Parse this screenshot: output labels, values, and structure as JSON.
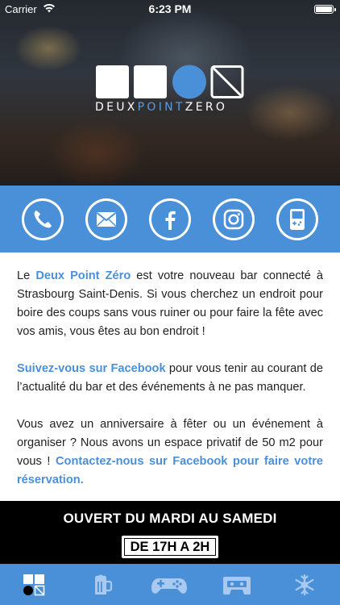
{
  "status_bar": {
    "carrier": "Carrier",
    "time": "6:23 PM"
  },
  "logo": {
    "part1": "DEUX",
    "part2": "POINT",
    "part3": "ZERO"
  },
  "social": [
    {
      "name": "phone-icon"
    },
    {
      "name": "mail-icon"
    },
    {
      "name": "facebook-icon"
    },
    {
      "name": "instagram-icon"
    },
    {
      "name": "gameboy-icon"
    }
  ],
  "content": {
    "p1_pre": "Le ",
    "p1_link": "Deux Point Zéro",
    "p1_post": " est votre nouveau bar connecté à Strasbourg Saint-Denis. Si vous cherchez un endroit pour boire des coups sans vous ruiner ou pour faire la fête avec vos amis, vous êtes au bon endroit !",
    "p2_link": "Suivez-vous sur Facebook",
    "p2_post": " pour vous tenir au courant de l’actualité du bar et des événements à ne pas manquer.",
    "p3_pre": "Vous avez un anniversaire à fêter ou un événement à organiser ? Nous avons un espace privatif de 50 m2 pour vous ! ",
    "p3_link": "Contactez-nous sur Facebook pour faire votre réservation."
  },
  "hours": {
    "title": "OUVERT DU MARDI AU SAMEDI",
    "time": "DE 17H A 2H"
  },
  "tabs": [
    {
      "name": "home-tab",
      "icon": "logo-icon",
      "active": true
    },
    {
      "name": "drinks-tab",
      "icon": "beer-icon",
      "active": false
    },
    {
      "name": "games-tab",
      "icon": "gamepad-icon",
      "active": false
    },
    {
      "name": "music-tab",
      "icon": "cassette-icon",
      "active": false
    },
    {
      "name": "settings-tab",
      "icon": "snowflake-icon",
      "active": false
    }
  ],
  "colors": {
    "accent": "#4a90d9",
    "black": "#000000",
    "white": "#ffffff"
  }
}
